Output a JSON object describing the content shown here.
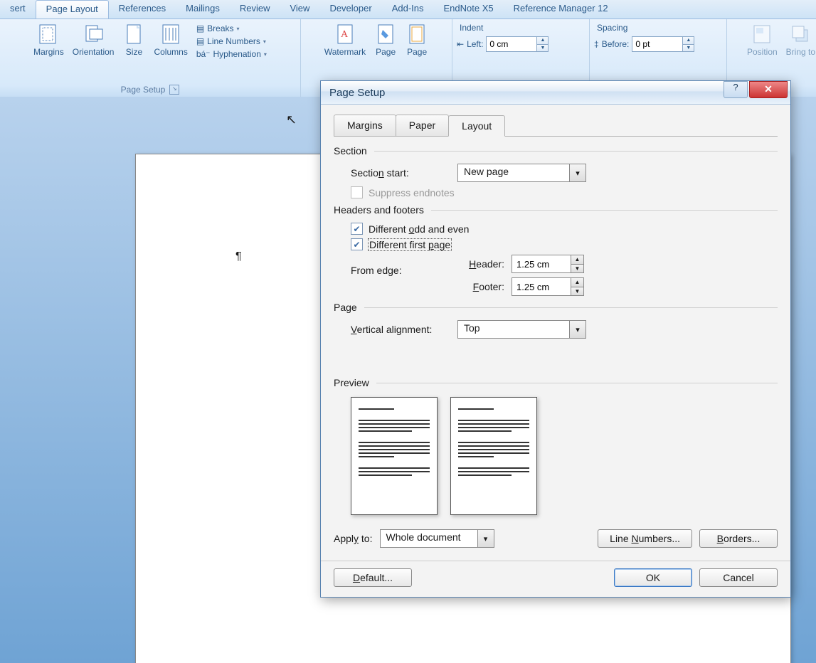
{
  "tabs": {
    "insert": "sert",
    "pageLayout": "Page Layout",
    "references": "References",
    "mailings": "Mailings",
    "review": "Review",
    "view": "View",
    "developer": "Developer",
    "addins": "Add-Ins",
    "endnote": "EndNote X5",
    "refman": "Reference Manager 12"
  },
  "ribbon": {
    "margins": "Margins",
    "orientation": "Orientation",
    "size": "Size",
    "columns": "Columns",
    "breaks": "Breaks",
    "lineNumbers": "Line Numbers",
    "hyphenation": "Hyphenation",
    "pageSetup": "Page Setup",
    "watermark": "Watermark",
    "pageColor": "Page",
    "pageBorders": "Page",
    "indent": "Indent",
    "left": "Left:",
    "leftVal": "0 cm",
    "spacing": "Spacing",
    "before": "Before:",
    "beforeVal": "0 pt",
    "position": "Position",
    "bring": "Bring to"
  },
  "dialog": {
    "title": "Page Setup",
    "tabMargins": "Margins",
    "tabPaper": "Paper",
    "tabLayout": "Layout",
    "section": "Section",
    "sectionStart": "Section start:",
    "sectionStartVal": "New page",
    "suppress": "Suppress endnotes",
    "headersFooters": "Headers and footers",
    "diffOddEven": "Different odd and even",
    "diffFirst": "Different first page",
    "fromEdge": "From edge:",
    "header": "Header:",
    "headerVal": "1.25 cm",
    "footer": "Footer:",
    "footerVal": "1.25 cm",
    "page": "Page",
    "vAlign": "Vertical alignment:",
    "vAlignVal": "Top",
    "preview": "Preview",
    "applyTo": "Apply to:",
    "applyToVal": "Whole document",
    "lineNumbersBtn": "Line Numbers...",
    "bordersBtn": "Borders...",
    "default": "Default...",
    "ok": "OK",
    "cancel": "Cancel"
  }
}
